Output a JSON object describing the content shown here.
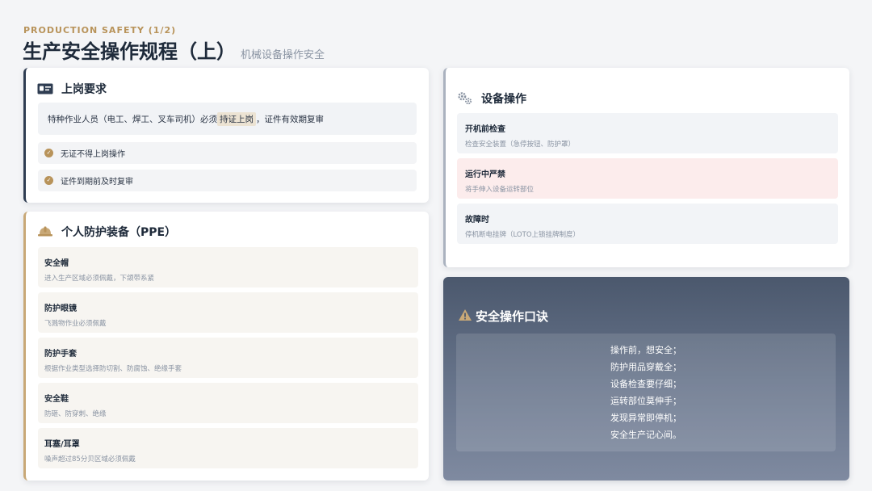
{
  "header": {
    "eyebrow": "PRODUCTION SAFETY (1/2)",
    "title": "生产安全操作规程（上）",
    "subtitle": "机械设备操作安全"
  },
  "job_requirements": {
    "title": "上岗要求",
    "icon": "id-card-icon",
    "note_prefix": "特种作业人员（电工、焊工、叉车司机）必须",
    "note_highlight": "持证上岗",
    "note_suffix": "，证件有效期复审",
    "checks": [
      "无证不得上岗操作",
      "证件到期前及时复审"
    ]
  },
  "ppe": {
    "title": "个人防护装备（PPE）",
    "icon": "hard-hat-icon",
    "items": [
      {
        "title": "安全帽",
        "desc": "进入生产区域必须佩戴，下颌带系紧"
      },
      {
        "title": "防护眼镜",
        "desc": "飞溅物作业必须佩戴"
      },
      {
        "title": "防护手套",
        "desc": "根据作业类型选择防切割、防腐蚀、绝缘手套"
      },
      {
        "title": "安全鞋",
        "desc": "防砸、防穿刺、绝缘"
      },
      {
        "title": "耳塞/耳罩",
        "desc": "噪声超过85分贝区域必须佩戴"
      }
    ]
  },
  "equipment": {
    "title": "设备操作",
    "icon": "gears-icon",
    "items": [
      {
        "title": "开机前检查",
        "desc": "检查安全装置（急停按钮、防护罩）"
      },
      {
        "title": "运行中严禁",
        "desc": "将手伸入设备运转部位"
      },
      {
        "title": "故障时",
        "desc": "停机断电挂牌（LOTO上锁挂牌制度）"
      }
    ]
  },
  "slogan": {
    "title": "安全操作口诀",
    "icon": "warning-icon",
    "lines": [
      "操作前，想安全；",
      "防护用品穿戴全；",
      "设备检查要仔细；",
      "运转部位莫伸手；",
      "发现异常即停机；",
      "安全生产记心间。"
    ]
  },
  "colors": {
    "accent_gold": "#b8935a",
    "dark_navy": "#2f3d52",
    "warn_bg": "#fcecec"
  }
}
